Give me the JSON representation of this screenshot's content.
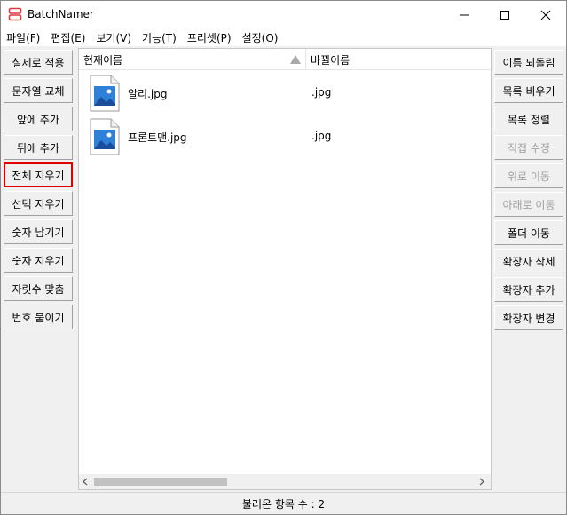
{
  "window": {
    "title": "BatchNamer"
  },
  "menu": [
    "파일(F)",
    "편집(E)",
    "보기(V)",
    "기능(T)",
    "프리셋(P)",
    "설정(O)"
  ],
  "left_buttons": [
    {
      "label": "실제로 적용",
      "state": "normal"
    },
    {
      "label": "문자열 교체",
      "state": "normal"
    },
    {
      "label": "앞에 추가",
      "state": "normal"
    },
    {
      "label": "뒤에 추가",
      "state": "normal"
    },
    {
      "label": "전체 지우기",
      "state": "highlighted"
    },
    {
      "label": "선택 지우기",
      "state": "normal"
    },
    {
      "label": "숫자 남기기",
      "state": "normal"
    },
    {
      "label": "숫자 지우기",
      "state": "normal"
    },
    {
      "label": "자릿수 맞춤",
      "state": "normal"
    },
    {
      "label": "번호 붙이기",
      "state": "normal"
    }
  ],
  "right_buttons": [
    {
      "label": "이름 되돌림",
      "state": "normal"
    },
    {
      "label": "목록 비우기",
      "state": "normal"
    },
    {
      "label": "목록 정렬",
      "state": "normal"
    },
    {
      "label": "직접 수정",
      "state": "disabled"
    },
    {
      "label": "위로 이동",
      "state": "disabled"
    },
    {
      "label": "아래로 이동",
      "state": "disabled"
    },
    {
      "label": "폴더 이동",
      "state": "normal"
    },
    {
      "label": "확장자 삭제",
      "state": "normal"
    },
    {
      "label": "확장자 추가",
      "state": "normal"
    },
    {
      "label": "확장자 변경",
      "state": "normal"
    }
  ],
  "list": {
    "columns": {
      "current": "현재이름",
      "new": "바뀔이름"
    },
    "rows": [
      {
        "current": "알리.jpg",
        "new": ".jpg"
      },
      {
        "current": "프론트맨.jpg",
        "new": ".jpg"
      }
    ]
  },
  "status": {
    "text": "불러온 항목 수 : 2"
  },
  "colors": {
    "highlight": "#e00000",
    "accent": "#1e6fd0"
  }
}
